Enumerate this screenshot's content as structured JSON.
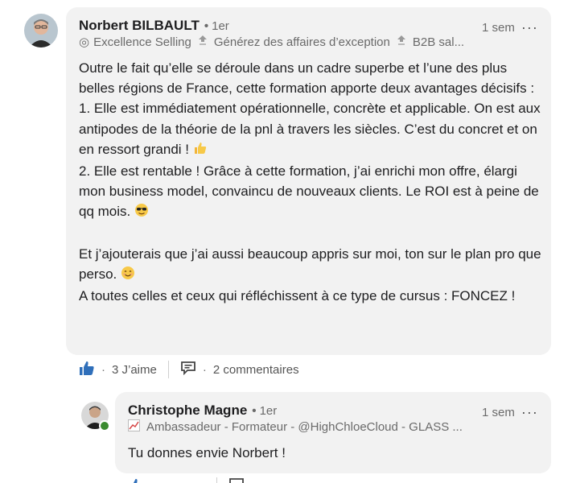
{
  "comment1": {
    "author": "Norbert BILBAULT",
    "degree": "1er",
    "time": "1 sem",
    "headline": {
      "part1": "Excellence Selling",
      "part2": "Générez des affaires d’exception",
      "part3": "B2B sal..."
    },
    "body": {
      "p1": "Outre le fait qu’elle se déroule dans un cadre superbe et l’une des plus belles régions de France, cette formation apporte deux avantages décisifs :",
      "p2": "1. Elle est immédiatement opérationnelle, concrète et applicable. On est aux antipodes de la théorie de la pnl à travers les siècles. C’est du concret et on en ressort grandi !",
      "p3": "2. Elle est rentable ! Grâce à cette formation, j’ai enrichi mon offre, élargi mon business model, convaincu de nouveaux clients. Le ROI est à peine de qq mois.",
      "p4": "Et j’ajouterais que j’ai aussi beaucoup appris sur moi, ton sur le plan pro que perso.",
      "p5": "A toutes celles et ceux qui réfléchissent à ce type de cursus : FONCEZ !"
    },
    "actions": {
      "like_count": "3 J’aime",
      "comments_count": "2 commentaires"
    }
  },
  "comment2": {
    "author": "Christophe Magne",
    "degree": "1er",
    "time": "1 sem",
    "headline": "Ambassadeur - Formateur - @HighChloeCloud - GLASS ...",
    "body": "Tu donnes envie Norbert !"
  },
  "colors": {
    "bubble": "#f2f2f2",
    "like_blue": "#2f6fba",
    "online_green": "#3a8a2f"
  }
}
